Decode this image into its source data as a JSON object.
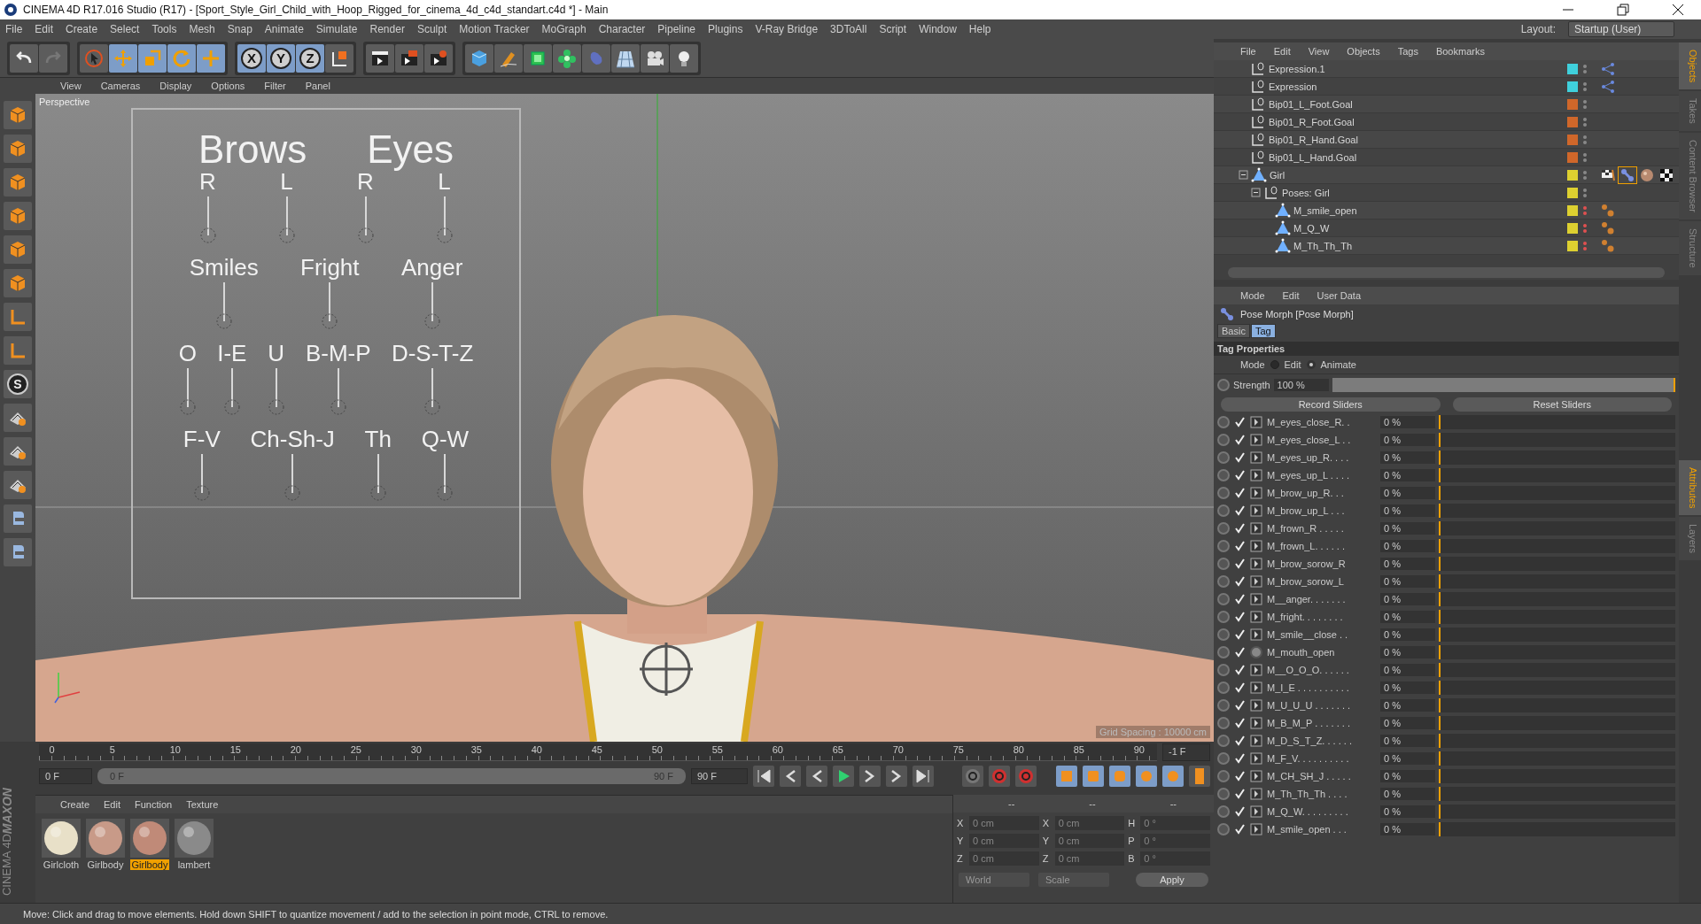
{
  "window": {
    "title": "CINEMA 4D R17.016 Studio (R17) - [Sport_Style_Girl_Child_with_Hoop_Rigged_for_cinema_4d_c4d_standart.c4d *] - Main"
  },
  "menu": [
    "File",
    "Edit",
    "Create",
    "Select",
    "Tools",
    "Mesh",
    "Snap",
    "Animate",
    "Simulate",
    "Render",
    "Sculpt",
    "Motion Tracker",
    "MoGraph",
    "Character",
    "Pipeline",
    "Plugins",
    "V-Ray Bridge",
    "3DToAll",
    "Script",
    "Window",
    "Help"
  ],
  "layout": {
    "label": "Layout:",
    "value": "Startup (User)"
  },
  "toolbar": {
    "tools": [
      {
        "selected": false
      },
      {
        "selected": true
      },
      {
        "selected": true
      },
      {
        "selected": true
      },
      {
        "selected": true
      }
    ],
    "axes": [
      {
        "label": "X",
        "selected": true
      },
      {
        "label": "Y",
        "selected": true
      },
      {
        "label": "Z",
        "selected": true
      }
    ]
  },
  "left_toolbar": {
    "snap_label": "S"
  },
  "viewport": {
    "menu": [
      "View",
      "Cameras",
      "Display",
      "Options",
      "Filter",
      "Panel"
    ],
    "camera": "Perspective",
    "grid_spacing": "Grid Spacing : 10000 cm",
    "rig_rows": [
      [
        {
          "label": "Brows",
          "kind": "title"
        },
        {
          "label": "Eyes",
          "kind": "title"
        }
      ],
      [
        {
          "label": "R",
          "kind": "control"
        },
        {
          "label": "L",
          "kind": "control"
        },
        {
          "label": "R",
          "kind": "control"
        },
        {
          "label": "L",
          "kind": "control"
        }
      ],
      [
        {
          "label": "Smiles",
          "kind": "control"
        },
        {
          "label": "Fright",
          "kind": "control"
        },
        {
          "label": "Anger",
          "kind": "control"
        }
      ],
      [
        {
          "label": "O",
          "kind": "control"
        },
        {
          "label": "I-E",
          "kind": "control"
        },
        {
          "label": "U",
          "kind": "control"
        },
        {
          "label": "B-M-P",
          "kind": "control"
        },
        {
          "label": "D-S-T-Z",
          "kind": "control"
        }
      ],
      [
        {
          "label": "F-V",
          "kind": "control"
        },
        {
          "label": "Ch-Sh-J",
          "kind": "control"
        },
        {
          "label": "Th",
          "kind": "control"
        },
        {
          "label": "Q-W",
          "kind": "control"
        }
      ]
    ]
  },
  "timeline": {
    "ticks": [
      "0",
      "5",
      "10",
      "15",
      "20",
      "25",
      "30",
      "35",
      "40",
      "45",
      "50",
      "55",
      "60",
      "65",
      "70",
      "75",
      "80",
      "85",
      "90"
    ],
    "frame_field": "-1 F"
  },
  "transport": {
    "start": "0 F",
    "range_start": "0 F",
    "range_end": "90 F",
    "end": "90 F",
    "level": 1
  },
  "materials": {
    "menu": [
      "Create",
      "Edit",
      "Function",
      "Texture"
    ],
    "items": [
      {
        "name": "Girlcloth",
        "selected": false,
        "color": "#e8e0c8"
      },
      {
        "name": "Girlbody",
        "selected": false,
        "color": "#c89a88"
      },
      {
        "name": "Girlbody",
        "selected": true,
        "color": "#c08a78"
      },
      {
        "name": "lambert",
        "selected": false,
        "color": "#8a8a8a"
      }
    ]
  },
  "coordinates": {
    "headers": [
      "--",
      "--",
      "--"
    ],
    "rows": [
      {
        "axis1": "X",
        "value1": "0 cm",
        "axis2": "X",
        "value2": "0 cm",
        "axis3": "H",
        "value3": "0 °"
      },
      {
        "axis1": "Y",
        "value1": "0 cm",
        "axis2": "Y",
        "value2": "0 cm",
        "axis3": "P",
        "value3": "0 °"
      },
      {
        "axis1": "Z",
        "value1": "0 cm",
        "axis2": "Z",
        "value2": "0 cm",
        "axis3": "B",
        "value3": "0 °"
      }
    ],
    "space": "World",
    "mode": "Scale",
    "apply": "Apply"
  },
  "logo": {
    "brand": "MAXON",
    "product": "CINEMA 4D"
  },
  "status_bar": "Move: Click and drag to move elements. Hold down SHIFT to quantize movement / add to the selection in point mode, CTRL to remove.",
  "objects": {
    "menu": [
      "File",
      "Edit",
      "View",
      "Objects",
      "Tags",
      "Bookmarks"
    ],
    "tree": [
      {
        "name": "Expression.1",
        "kind": "null",
        "color": "#3fd0dc",
        "hidden": false,
        "tags": [
          {
            "kind": "xpresso",
            "selected": false
          }
        ]
      },
      {
        "name": "Expression",
        "kind": "null",
        "color": "#3fd0dc",
        "hidden": false,
        "tags": [
          {
            "kind": "xpresso",
            "selected": false
          }
        ]
      },
      {
        "name": "Bip01_L_Foot.Goal",
        "kind": "null",
        "color": "#d0672a",
        "hidden": false
      },
      {
        "name": "Bip01_R_Foot.Goal",
        "kind": "null",
        "color": "#d0672a",
        "hidden": false
      },
      {
        "name": "Bip01_R_Hand.Goal",
        "kind": "null",
        "color": "#d0672a",
        "hidden": false
      },
      {
        "name": "Bip01_L_Hand.Goal",
        "kind": "null",
        "color": "#d0672a",
        "hidden": false
      },
      {
        "name": "Girl",
        "kind": "polygon",
        "color": "#ddd030",
        "hidden": false,
        "expanded": true,
        "tags": [
          {
            "kind": "flag",
            "selected": false
          },
          {
            "kind": "posemorph",
            "selected": true
          },
          {
            "kind": "material",
            "selected": false
          },
          {
            "kind": "checker",
            "selected": false
          }
        ],
        "children": [
          {
            "name": "Poses: Girl",
            "kind": "null",
            "color": "#ddd030",
            "hidden": false,
            "expanded": true,
            "children": [
              {
                "name": "M_smile_open",
                "kind": "polygon",
                "color": "#ddd030",
                "hidden": true,
                "tags": [
                  {
                    "kind": "points",
                    "selected": false
                  }
                ]
              },
              {
                "name": "M_Q_W",
                "kind": "polygon",
                "color": "#ddd030",
                "hidden": true,
                "tags": [
                  {
                    "kind": "points",
                    "selected": false
                  }
                ]
              },
              {
                "name": "M_Th_Th_Th",
                "kind": "polygon",
                "color": "#ddd030",
                "hidden": true,
                "tags": [
                  {
                    "kind": "points",
                    "selected": false
                  }
                ]
              }
            ]
          }
        ]
      }
    ]
  },
  "attributes": {
    "menu": [
      "Mode",
      "Edit",
      "User Data"
    ],
    "title": "Pose Morph [Pose Morph]",
    "tabs": [
      {
        "label": "Basic",
        "selected": false
      },
      {
        "label": "Tag",
        "selected": true
      }
    ],
    "section": "Tag Properties",
    "mode": {
      "label": "Mode",
      "options": [
        {
          "label": "Edit",
          "selected": false
        },
        {
          "label": "Animate",
          "selected": true
        }
      ]
    },
    "strength": {
      "label": "Strength",
      "value": "100 %",
      "level": 1
    },
    "buttons": [
      "Record Sliders",
      "Reset Sliders"
    ],
    "sliders": [
      {
        "name": "M_eyes_close_R. .",
        "value": "0 %",
        "level": 0,
        "checked": true,
        "kind": "morph"
      },
      {
        "name": "M_eyes_close_L . .",
        "value": "0 %",
        "level": 0,
        "checked": true,
        "kind": "morph"
      },
      {
        "name": "M_eyes_up_R. . . .",
        "value": "0 %",
        "level": 0,
        "checked": true,
        "kind": "morph"
      },
      {
        "name": "M_eyes_up_L . . . .",
        "value": "0 %",
        "level": 0,
        "checked": true,
        "kind": "morph"
      },
      {
        "name": "M_brow_up_R. . .",
        "value": "0 %",
        "level": 0,
        "checked": true,
        "kind": "morph"
      },
      {
        "name": "M_brow_up_L . . .",
        "value": "0 %",
        "level": 0,
        "checked": true,
        "kind": "morph"
      },
      {
        "name": "M_frown_R . . . . .",
        "value": "0 %",
        "level": 0,
        "checked": true,
        "kind": "morph"
      },
      {
        "name": "M_frown_L. . . . . .",
        "value": "0 %",
        "level": 0,
        "checked": true,
        "kind": "morph"
      },
      {
        "name": "M_brow_sorow_R",
        "value": "0 %",
        "level": 0,
        "checked": true,
        "kind": "morph"
      },
      {
        "name": "M_brow_sorow_L",
        "value": "0 %",
        "level": 0,
        "checked": true,
        "kind": "morph"
      },
      {
        "name": "M__anger. . . . . . .",
        "value": "0 %",
        "level": 0,
        "checked": true,
        "kind": "morph"
      },
      {
        "name": "M_fright. . . . . . . .",
        "value": "0 %",
        "level": 0,
        "checked": true,
        "kind": "morph"
      },
      {
        "name": "M_smile__close . .",
        "value": "0 %",
        "level": 0,
        "checked": true,
        "kind": "morph"
      },
      {
        "name": "M_mouth_open",
        "value": "0 %",
        "level": 0,
        "checked": true,
        "kind": "point"
      },
      {
        "name": "M__O_O_O. . . . . .",
        "value": "0 %",
        "level": 0,
        "checked": true,
        "kind": "morph"
      },
      {
        "name": "M_I_E . . . . . . . . . .",
        "value": "0 %",
        "level": 0,
        "checked": true,
        "kind": "morph"
      },
      {
        "name": "M_U_U_U . . . . . . .",
        "value": "0 %",
        "level": 0,
        "checked": true,
        "kind": "morph"
      },
      {
        "name": "M_B_M_P . . . . . . .",
        "value": "0 %",
        "level": 0,
        "checked": true,
        "kind": "morph"
      },
      {
        "name": "M_D_S_T_Z. . . . . .",
        "value": "0 %",
        "level": 0,
        "checked": true,
        "kind": "morph"
      },
      {
        "name": "M_F_V. . . . . . . . . .",
        "value": "0 %",
        "level": 0,
        "checked": true,
        "kind": "morph"
      },
      {
        "name": "M_CH_SH_J . . . . .",
        "value": "0 %",
        "level": 0,
        "checked": true,
        "kind": "morph"
      },
      {
        "name": "M_Th_Th_Th . . . .",
        "value": "0 %",
        "level": 0,
        "checked": true,
        "kind": "morph"
      },
      {
        "name": "M_Q_W. . . . . . . . .",
        "value": "0 %",
        "level": 0,
        "checked": true,
        "kind": "morph"
      },
      {
        "name": "M_smile_open . . .",
        "value": "0 %",
        "level": 0,
        "checked": true,
        "kind": "morph"
      }
    ]
  },
  "side_tabs_top": [
    {
      "label": "Objects",
      "selected": true
    },
    {
      "label": "Takes",
      "selected": false
    },
    {
      "label": "Content Browser",
      "selected": false
    },
    {
      "label": "Structure",
      "selected": false
    }
  ],
  "side_tabs_bottom": [
    {
      "label": "Attributes",
      "selected": true
    },
    {
      "label": "Layers",
      "selected": false
    }
  ]
}
